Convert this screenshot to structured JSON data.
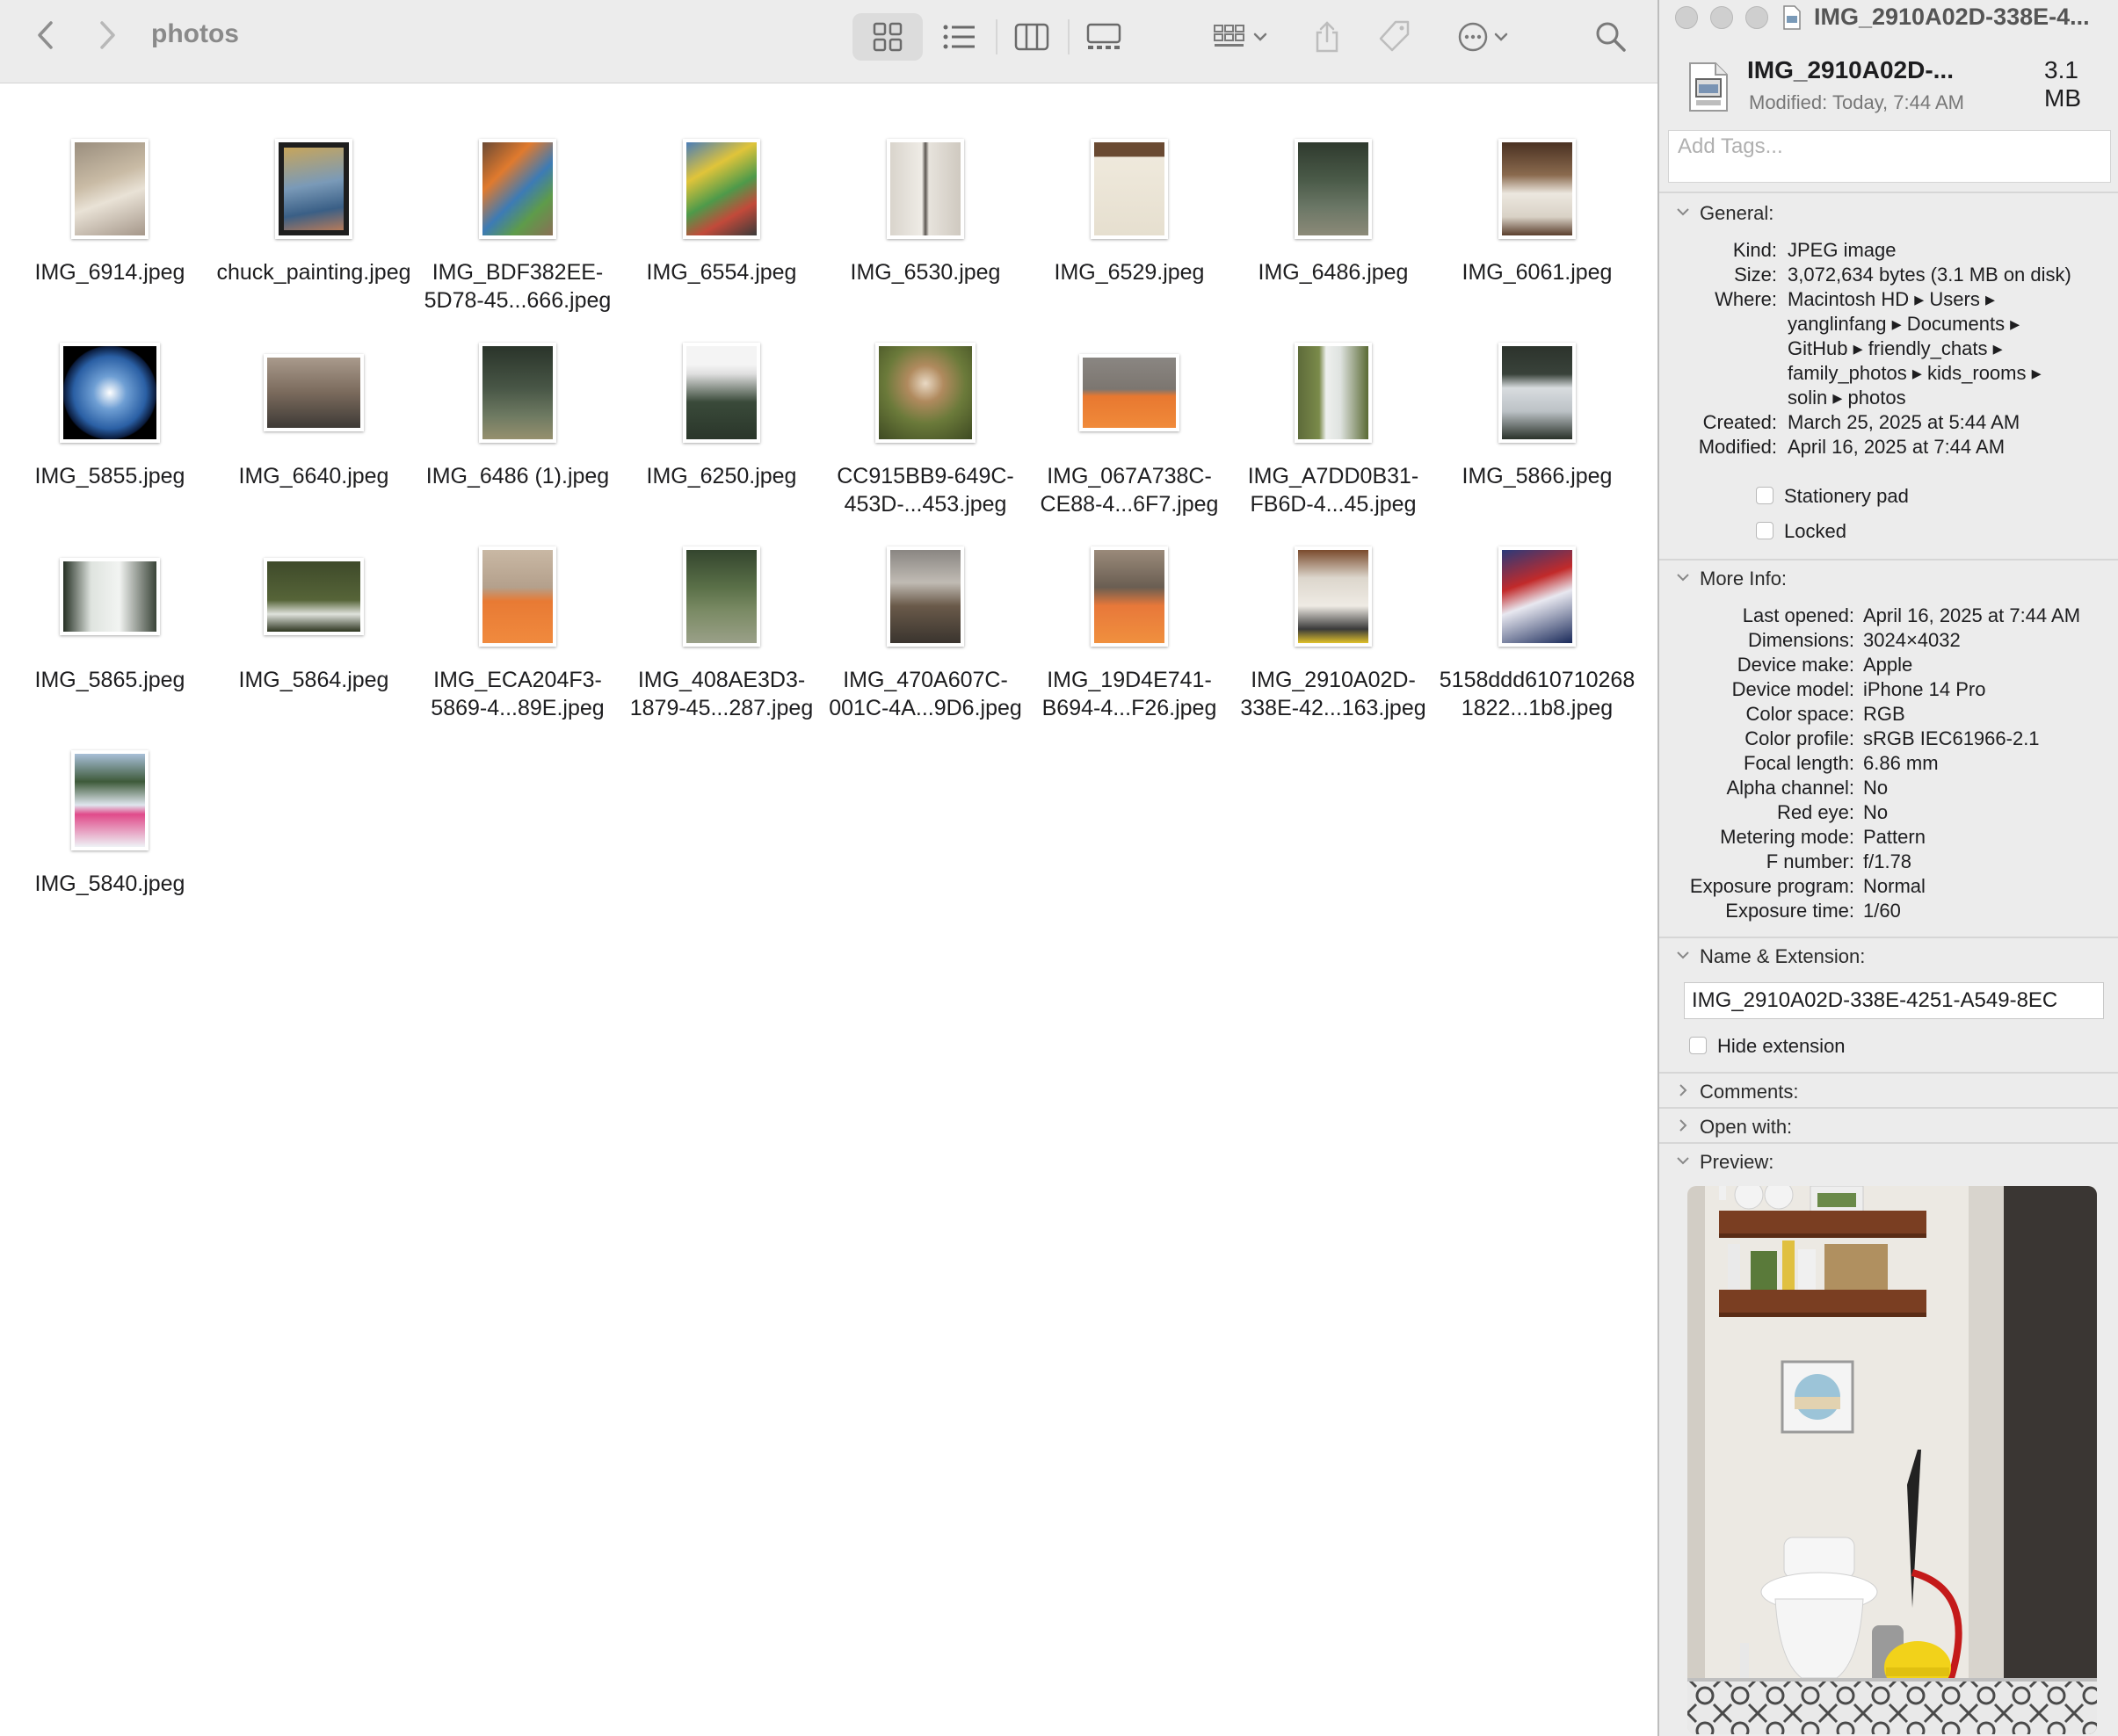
{
  "finder": {
    "folder_title": "photos",
    "items": [
      {
        "name": "IMG_6914.jpeg"
      },
      {
        "name": "chuck_painting.jpeg"
      },
      {
        "name": "IMG_BDF382EE-5D78-45...666.jpeg"
      },
      {
        "name": "IMG_6554.jpeg"
      },
      {
        "name": "IMG_6530.jpeg"
      },
      {
        "name": "IMG_6529.jpeg"
      },
      {
        "name": "IMG_6486.jpeg"
      },
      {
        "name": "IMG_6061.jpeg"
      },
      {
        "name": "IMG_5855.jpeg"
      },
      {
        "name": "IMG_6640.jpeg"
      },
      {
        "name": "IMG_6486 (1).jpeg"
      },
      {
        "name": "IMG_6250.jpeg"
      },
      {
        "name": "CC915BB9-649C-453D-...453.jpeg"
      },
      {
        "name": "IMG_067A738C-CE88-4...6F7.jpeg"
      },
      {
        "name": "IMG_A7DD0B31-FB6D-4...45.jpeg"
      },
      {
        "name": "IMG_5866.jpeg"
      },
      {
        "name": "IMG_5865.jpeg"
      },
      {
        "name": "IMG_5864.jpeg"
      },
      {
        "name": "IMG_ECA204F3-5869-4...89E.jpeg"
      },
      {
        "name": "IMG_408AE3D3-1879-45...287.jpeg"
      },
      {
        "name": "IMG_470A607C-001C-4A...9D6.jpeg"
      },
      {
        "name": "IMG_19D4E741-B694-4...F26.jpeg"
      },
      {
        "name": "IMG_2910A02D-338E-42...163.jpeg"
      },
      {
        "name": "5158ddd6107102681822...1b8.jpeg"
      },
      {
        "name": "IMG_5840.jpeg"
      }
    ]
  },
  "info": {
    "window_title": "IMG_2910A02D-338E-4...",
    "file_name": "IMG_2910A02D-...",
    "file_size": "3.1 MB",
    "modified_summary": "Modified: Today, 7:44 AM",
    "tags_placeholder": "Add Tags...",
    "general": {
      "title": "General:",
      "kind_label": "Kind:",
      "kind": "JPEG image",
      "size_label": "Size:",
      "size": "3,072,634 bytes (3.1 MB on disk)",
      "where_label": "Where:",
      "where_lines": [
        "Macintosh HD ▸ Users ▸",
        "yanglinfang ▸ Documents ▸",
        "GitHub ▸ friendly_chats ▸",
        "family_photos ▸ kids_rooms ▸",
        "solin ▸ photos"
      ],
      "created_label": "Created:",
      "created": "March 25, 2025 at 5:44 AM",
      "modified_label": "Modified:",
      "modified": "April 16, 2025 at 7:44 AM",
      "stationery_label": "Stationery pad",
      "locked_label": "Locked"
    },
    "more_info": {
      "title": "More Info:",
      "rows": [
        {
          "k": "Last opened:",
          "v": "April 16, 2025 at 7:44 AM"
        },
        {
          "k": "Dimensions:",
          "v": "3024×4032"
        },
        {
          "k": "Device make:",
          "v": "Apple"
        },
        {
          "k": "Device model:",
          "v": "iPhone 14 Pro"
        },
        {
          "k": "Color space:",
          "v": "RGB"
        },
        {
          "k": "Color profile:",
          "v": "sRGB IEC61966-2.1"
        },
        {
          "k": "Focal length:",
          "v": "6.86 mm"
        },
        {
          "k": "Alpha channel:",
          "v": "No"
        },
        {
          "k": "Red eye:",
          "v": "No"
        },
        {
          "k": "Metering mode:",
          "v": "Pattern"
        },
        {
          "k": "F number:",
          "v": "f/1.78"
        },
        {
          "k": "Exposure program:",
          "v": "Normal"
        },
        {
          "k": "Exposure time:",
          "v": "1/60"
        }
      ]
    },
    "name_ext": {
      "title": "Name & Extension:",
      "value": "IMG_2910A02D-338E-4251-A549-8EC",
      "hide_label": "Hide extension"
    },
    "comments_title": "Comments:",
    "open_with_title": "Open with:",
    "preview_title": "Preview:"
  }
}
